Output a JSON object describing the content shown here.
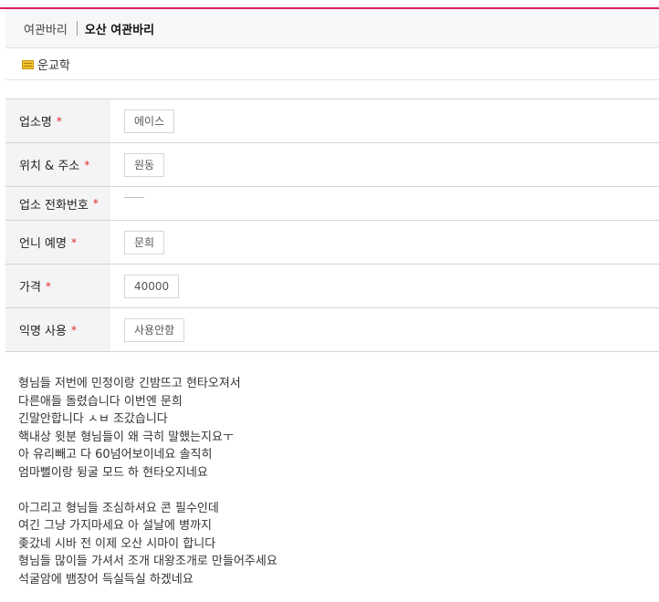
{
  "colors": {
    "accent": "#d81e63",
    "required": "#e2262a",
    "label_bg": "#f4f4f6"
  },
  "breadcrumb": {
    "parent": "여관바리",
    "current": "오산 여관바리"
  },
  "author": {
    "icon": "user-level-icon",
    "name": "운교학"
  },
  "form": {
    "required_mark": "*",
    "fields": [
      {
        "label": "업소명",
        "value": "에이스"
      },
      {
        "label": "위치 & 주소",
        "value": "원동"
      },
      {
        "label": "업소 전화번호",
        "value": ""
      },
      {
        "label": "언니 예명",
        "value": "문희"
      },
      {
        "label": "가격",
        "value": "40000"
      },
      {
        "label": "익명 사용",
        "value": "사용안함"
      }
    ]
  },
  "content": {
    "lines": [
      "형님들 저번에 민정이랑 긴밤뜨고 현타오져서",
      "다른애들 돌렸습니다 이번엔 문희",
      "긴말안합니다 ㅅㅂ 조갔습니다",
      "핵내상 윗분 형님들이 왜 극히 말했는지요ㅜ",
      "아 유리빼고 다 60넘어보이네요 솔직히",
      "엄마뻘이랑 뒹굴 모드 하 현타오지네요",
      "",
      "아그리고 형님들 조심하셔요 콘 필수인데",
      "여긴 그냥 가지마세요 아  설날에 병까지",
      "좆갔네 시바   전 이제 오산 시마이 합니다",
      "형님들 많이들 가셔서  조개  대왕조개로 만들어주세요",
      "석굴암에  뱀장어 득실득실 하겠네요"
    ]
  }
}
